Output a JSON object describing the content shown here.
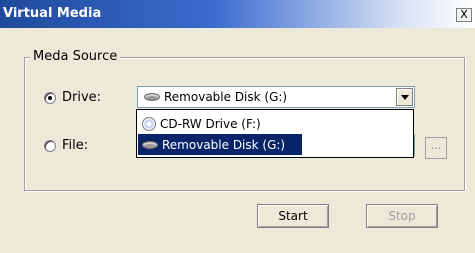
{
  "window": {
    "title": "Virtual Media",
    "close_label": "X"
  },
  "group": {
    "legend": "Meda Source"
  },
  "drive": {
    "label": "Drive:",
    "selected": "Removable Disk (G:)",
    "options": [
      {
        "label": "CD-RW Drive (F:)",
        "icon": "cd-drive-icon"
      },
      {
        "label": "Removable Disk (G:)",
        "icon": "removable-disk-icon"
      }
    ]
  },
  "file": {
    "label": "File:",
    "value": "",
    "browse_label": "..."
  },
  "buttons": {
    "start": "Start",
    "stop": "Stop"
  },
  "colors": {
    "title_bar_start": "#1f4a9c",
    "selection": "#0a246a",
    "dialog_bg": "#ece9d8"
  }
}
